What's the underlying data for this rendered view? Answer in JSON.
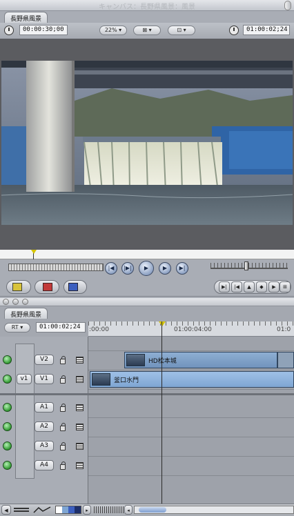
{
  "canvas": {
    "title": "キャンバス：長野県風景：風景",
    "tab": "長野県風景",
    "duration": "00:00:30;00",
    "zoom": "22%",
    "current_timecode": "01:00:02;24"
  },
  "timeline": {
    "tab": "長野県風景",
    "rt_label": "RT",
    "current_timecode": "01:00:02;24",
    "ruler_labels": [
      ":00:00",
      "01:00:04:00",
      "01:0"
    ],
    "video_tracks": [
      {
        "label": "V2",
        "source": ""
      },
      {
        "label": "V1",
        "source": "v1"
      }
    ],
    "audio_tracks": [
      {
        "label": "A1"
      },
      {
        "label": "A2"
      },
      {
        "label": "A3"
      },
      {
        "label": "A4"
      }
    ],
    "clips": {
      "v2": "HD松本城",
      "v1": "釜口水門"
    }
  }
}
